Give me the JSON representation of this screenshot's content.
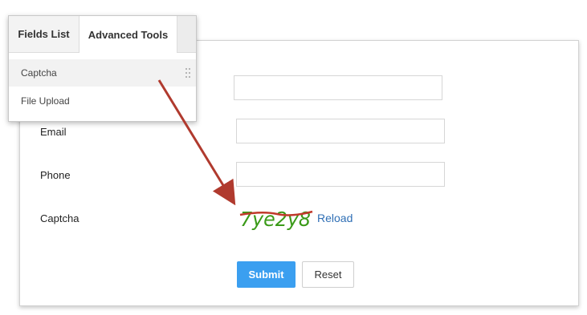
{
  "panel": {
    "tabs": [
      {
        "label": "Fields List"
      },
      {
        "label": "Advanced Tools"
      }
    ],
    "items": [
      {
        "label": "Captcha"
      },
      {
        "label": "File Upload"
      }
    ]
  },
  "form": {
    "fields": [
      {
        "label": "Email"
      },
      {
        "label": "Phone"
      },
      {
        "label": "Captcha"
      }
    ],
    "captcha_text": "7ye2y8",
    "reload_label": "Reload",
    "submit_label": "Submit",
    "reset_label": "Reset"
  },
  "colors": {
    "submit_bg": "#3b9ff0",
    "link": "#2f6fb5",
    "captcha_text": "#3a9a18",
    "captcha_strike": "#c0392b",
    "annotation_arrow": "#b03a2e"
  }
}
